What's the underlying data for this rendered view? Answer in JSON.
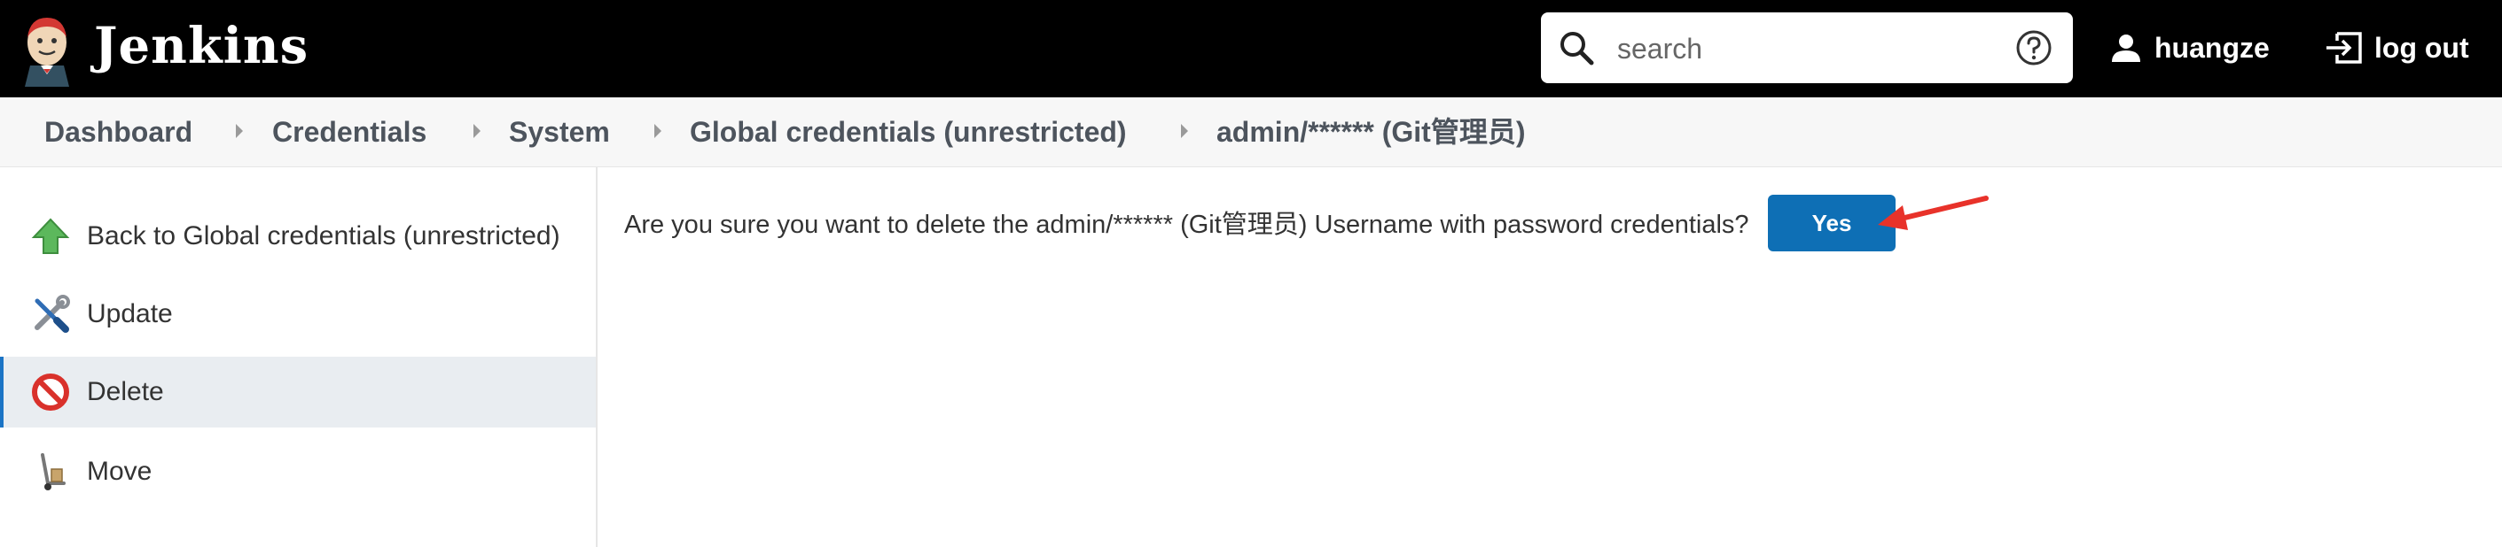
{
  "header": {
    "brand": "Jenkins",
    "search": {
      "placeholder": "search",
      "value": ""
    },
    "user_name": "huangze",
    "logout_label": "log out",
    "icons": {
      "logo": "jenkins-butler-icon",
      "search": "search-icon",
      "help": "help-icon",
      "user": "user-icon",
      "logout": "logout-icon"
    }
  },
  "breadcrumb": {
    "items": [
      "Dashboard",
      "Credentials",
      "System",
      "Global credentials (unrestricted)",
      "admin/****** (Git管理员)"
    ]
  },
  "sidebar": {
    "items": [
      {
        "label": "Back to Global credentials (unrestricted)",
        "icon": "up-arrow-icon",
        "active": false
      },
      {
        "label": "Update",
        "icon": "wrench-screwdriver-icon",
        "active": false
      },
      {
        "label": "Delete",
        "icon": "no-entry-icon",
        "active": true
      },
      {
        "label": "Move",
        "icon": "hand-truck-icon",
        "active": false
      }
    ]
  },
  "main": {
    "confirm_text": "Are you sure you want to delete the admin/****** (Git管理员) Username with password credentials?",
    "yes_label": "Yes"
  },
  "colors": {
    "header_bg": "#000000",
    "breadcrumb_bg": "#f7f7f7",
    "active_item_bg": "#e9edf1",
    "button_bg": "#0e6fb5",
    "annotation_arrow": "#e8322a"
  }
}
